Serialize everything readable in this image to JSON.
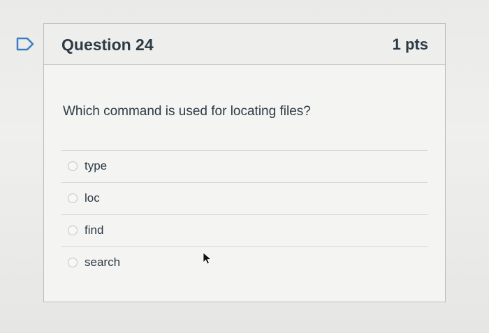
{
  "question": {
    "title": "Question 24",
    "points": "1 pts",
    "text": "Which command is used for locating files?",
    "flag_icon": "flag-icon",
    "answers": [
      {
        "label": "type",
        "selected": false
      },
      {
        "label": "loc",
        "selected": false
      },
      {
        "label": "find",
        "selected": false
      },
      {
        "label": "search",
        "selected": false
      }
    ]
  },
  "colors": {
    "text": "#2d3b45",
    "card_border": "#b9bcbf",
    "flag_outline": "#3b7ec6"
  },
  "cursor": "arrow-cursor-icon"
}
